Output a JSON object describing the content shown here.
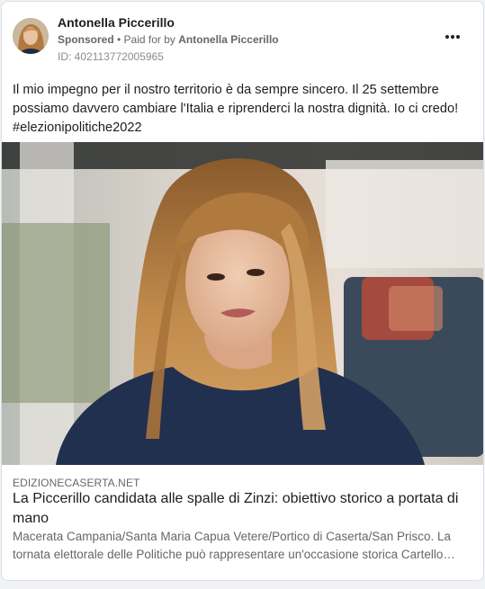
{
  "post": {
    "author": "Antonella Piccerillo",
    "sponsored_label": "Sponsored",
    "separator": " • ",
    "paid_for_prefix": "Paid for by ",
    "paid_for_name": "Antonella Piccerillo",
    "ad_id": "ID: 402113772005965",
    "body_lines": [
      "Il mio impegno per il nostro territorio è da sempre sincero. Il 25 settembre",
      "possiamo davvero cambiare l'Italia e riprenderci la nostra dignità. Io ci credo!",
      "#elezionipolitiche2022"
    ],
    "more_icon": "more-horizontal-icon"
  },
  "link": {
    "domain": "EDIZIONECASERTA.NET",
    "headline_lines": [
      "La Piccerillo candidata alle spalle di Zinzi: obiettivo storico a portata di",
      "mano"
    ],
    "description_lines": [
      "Macerata Campania/Santa Maria Capua Vetere/Portico di Caserta/San Prisco. La",
      "tornata elettorale delle Politiche può rappresentare un'occasione storica Cartello…"
    ]
  },
  "colors": {
    "text_primary": "#1c1e21",
    "text_secondary": "#65676b",
    "card_border": "#dddfe2"
  }
}
